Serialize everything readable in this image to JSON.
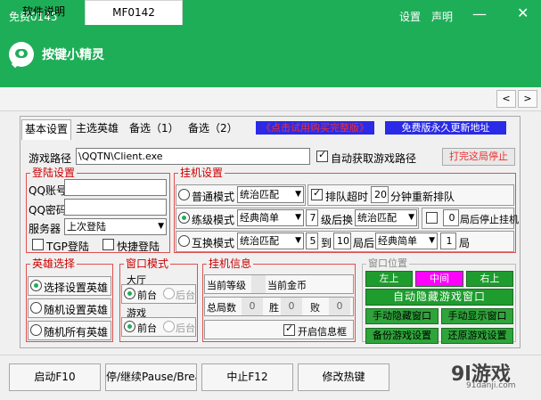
{
  "window": {
    "title": "免费0145",
    "settings": "设置",
    "statement": "声明",
    "minimize": "—",
    "close": "✕",
    "app_name": "按键小精灵"
  },
  "main_tabs": [
    "软件说明",
    "MF0142"
  ],
  "nav": {
    "prev": "<",
    "next": ">"
  },
  "sub_tabs": [
    "基本设置",
    "主选英雄",
    "备选（1）",
    "备选（2）"
  ],
  "banners": {
    "trial": "《点击试用购买完整版》",
    "update": "免费版永久更新地址"
  },
  "game_path": {
    "label": "游戏路径",
    "value": "\\QQTN\\Client.exe",
    "auto_label": "自动获取游戏路径",
    "stop_btn": "打完这局停止"
  },
  "login": {
    "title": "登陆设置",
    "qq_label": "QQ账号",
    "pwd_label": "QQ密码",
    "server_label": "服务器",
    "server_value": "上次登陆",
    "tgp_label": "TGP登陆",
    "quick_label": "快捷登陆"
  },
  "hang": {
    "title": "挂机设置",
    "normal_label": "普通模式",
    "normal_match": "统治匹配",
    "queue_timeout": "排队超时",
    "queue_value": "20",
    "queue_suffix": "分钟重新排队",
    "level_label": "练级模式",
    "level_select": "经典简单",
    "level_num": "7",
    "level_suffix": "级后换",
    "level_match": "统治匹配",
    "stop_value": "0",
    "stop_suffix": "局后停止挂机",
    "swap_label": "互换模式",
    "swap_match": "统治匹配",
    "swap_from": "5",
    "swap_to_label": "到",
    "swap_to": "10",
    "swap_after": "局后",
    "swap_select": "经典简单",
    "swap_n": "1",
    "swap_unit": "局"
  },
  "hero": {
    "title": "英雄选择",
    "opt1": "选择设置英雄",
    "opt2": "随机设置英雄",
    "opt3": "随机所有英雄"
  },
  "window_mode": {
    "title": "窗口模式",
    "hall": "大厅",
    "game": "游戏",
    "front": "前台",
    "back": "后台"
  },
  "hang_info": {
    "title": "挂机信息",
    "level_label": "当前等级",
    "gold_label": "当前金币",
    "total_label": "总局数",
    "total": "0",
    "win_label": "胜",
    "win": "0",
    "lose_label": "败",
    "lose": "0",
    "show_box": "开启信息框"
  },
  "window_pos": {
    "title": "窗口位置",
    "left_top": "左上",
    "center": "中间",
    "right_top": "右上",
    "auto_hide": "自动隐藏游戏窗口",
    "manual_hide": "手动隐藏窗口",
    "manual_show": "手动显示窗口",
    "backup": "备份游戏设置",
    "restore": "还原游戏设置"
  },
  "bottom": {
    "start": "启动F10",
    "pause": "停/继续Pause/Break",
    "stop": "中止F12",
    "hotkey": "修改热键"
  },
  "watermark": {
    "brand": "9l游戏",
    "url": "91danji.com"
  }
}
